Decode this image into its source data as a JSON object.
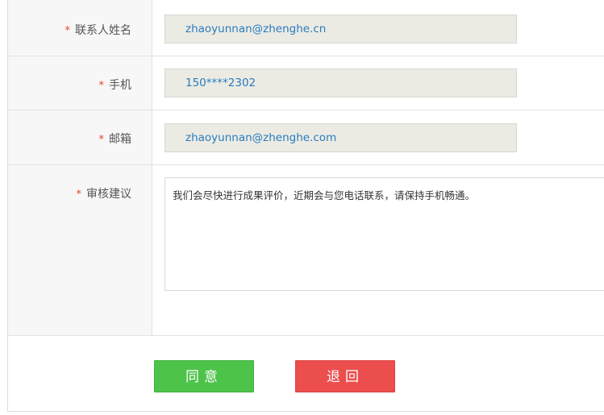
{
  "form": {
    "rows": [
      {
        "label": "联系人姓名",
        "required_mark": "*",
        "value": "zhaoyunnan@zhenghe.cn"
      },
      {
        "label": "手机",
        "required_mark": "*",
        "value": "150****2302"
      },
      {
        "label": "邮箱",
        "required_mark": "*",
        "value": "zhaoyunnan@zhenghe.com"
      }
    ],
    "review": {
      "label": "审核建议",
      "required_mark": "*",
      "text": "我们会尽快进行成果评价，近期会与您电话联系，请保持手机畅通。"
    }
  },
  "actions": {
    "agree_label": "同意",
    "return_label": "退回"
  },
  "colors": {
    "agree": "#4dc34a",
    "return": "#ec4d4d",
    "required": "#e8412e",
    "value_text": "#2a7bbd"
  }
}
